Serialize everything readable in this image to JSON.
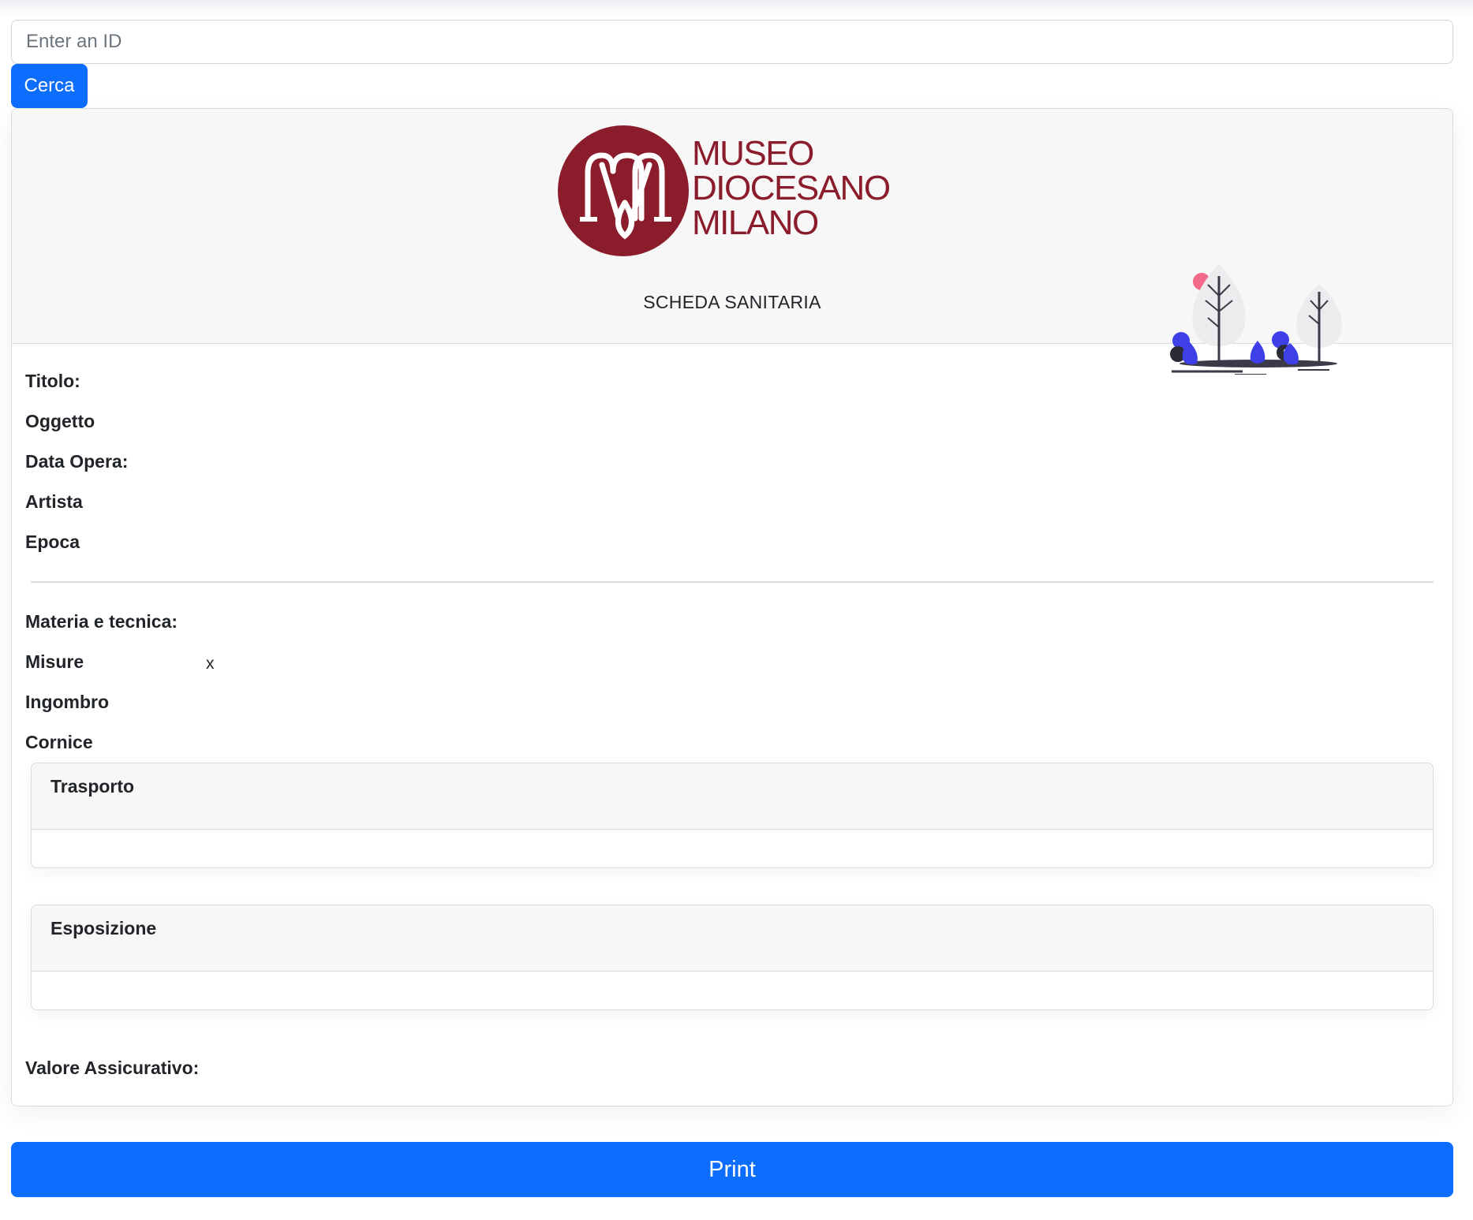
{
  "search": {
    "placeholder": "Enter an ID",
    "value": ""
  },
  "search_button_label": "Cerca",
  "header": {
    "logo_lines": [
      "MUSEO",
      "DIOCESANO",
      "MILANO"
    ],
    "subtitle": "SCHEDA SANITARIA"
  },
  "fields_top": {
    "titolo": "Titolo:",
    "oggetto": "Oggetto",
    "data_opera": "Data Opera:",
    "artista": "Artista",
    "epoca": "Epoca"
  },
  "fields_bottom": {
    "materia": "Materia e tecnica:",
    "misure": "Misure",
    "misure_separator": "x",
    "ingombro": "Ingombro",
    "cornice": "Cornice"
  },
  "sections": {
    "trasporto": "Trasporto",
    "esposizione": "Esposizione"
  },
  "valore_assicurativo": "Valore Assicurativo:",
  "print_button_label": "Print",
  "colors": {
    "primary": "#0d6efd",
    "logo_red": "#8b1c2c",
    "illustration_blue": "#3f3fe8",
    "illustration_pink": "#f46a8a"
  }
}
